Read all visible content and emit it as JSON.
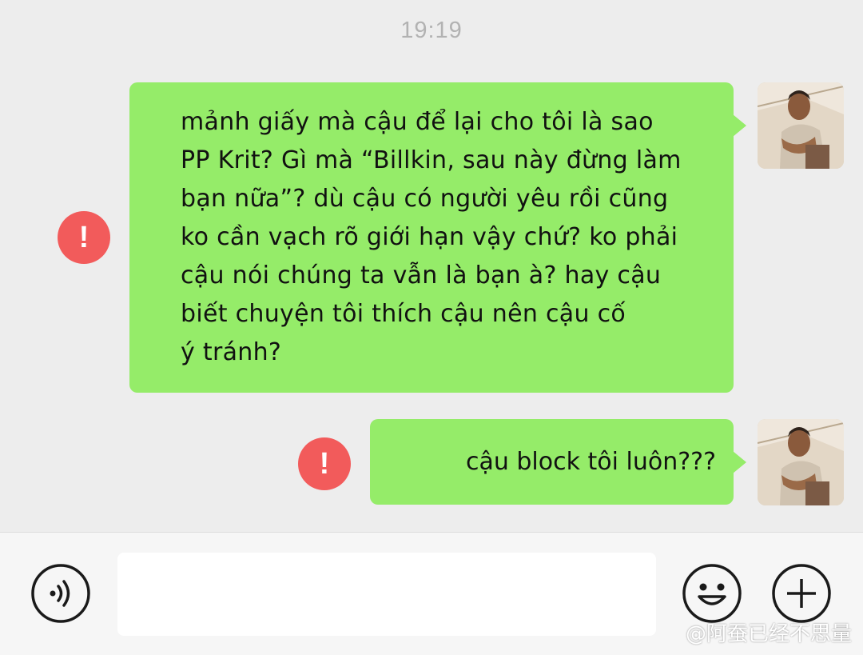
{
  "chat": {
    "timestamp": "19:19",
    "messages": [
      {
        "lines": [
          "mảnh giấy mà cậu để lại cho tôi là sao",
          "PP Krit? Gì mà “Billkin, sau này đừng làm",
          "bạn nữa”? dù cậu có người yêu rồi cũng",
          "ko cần vạch rõ giới hạn vậy chứ? ko phải",
          "cậu nói chúng ta vẫn là bạn à? hay cậu",
          "biết chuyện tôi thích cậu nên cậu cố",
          "ý tránh?"
        ],
        "status_icon": "error-icon",
        "status_symbol": "!"
      },
      {
        "text": "cậu block tôi luôn???",
        "status_icon": "error-icon",
        "status_symbol": "!"
      }
    ]
  },
  "input_bar": {
    "message_value": "",
    "voice_icon": "voice-icon",
    "emoji_icon": "emoji-icon",
    "more_icon": "plus-icon"
  },
  "watermark": {
    "corner_text": "@阿蚕已经不思量"
  },
  "colors": {
    "background": "#ededed",
    "bubble_sent": "#95ec69",
    "error": "#f25b5b",
    "timestamp": "#b2b2b2"
  }
}
